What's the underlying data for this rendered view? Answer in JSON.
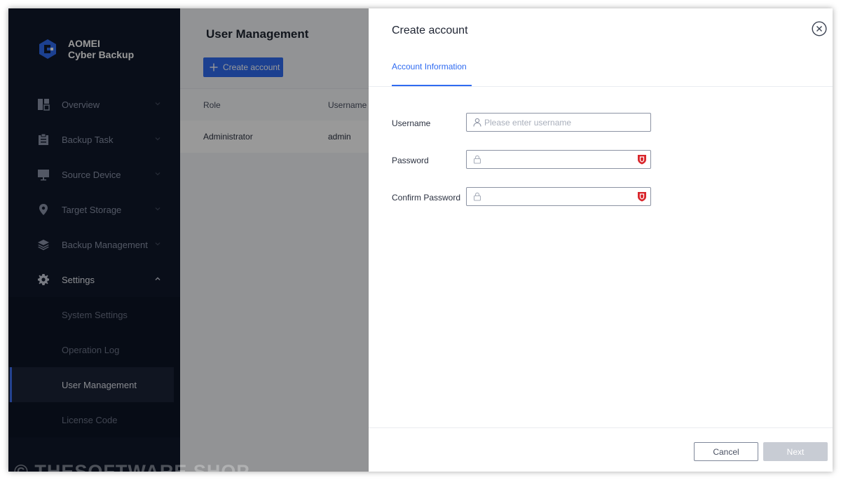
{
  "app": {
    "brand_line1": "AOMEI",
    "brand_line2": "Cyber Backup",
    "accent_color": "#2f6bf1",
    "sidebar_color": "#10182b"
  },
  "sidebar": {
    "items": [
      {
        "label": "Overview",
        "icon": "dashboard-icon"
      },
      {
        "label": "Backup Task",
        "icon": "clipboard-icon"
      },
      {
        "label": "Source Device",
        "icon": "monitor-icon"
      },
      {
        "label": "Target Storage",
        "icon": "location-pin-icon"
      },
      {
        "label": "Backup Management",
        "icon": "layers-icon"
      },
      {
        "label": "Settings",
        "icon": "gear-icon"
      }
    ],
    "settings_sub": [
      {
        "label": "System Settings"
      },
      {
        "label": "Operation Log"
      },
      {
        "label": "User Management"
      },
      {
        "label": "License Code"
      }
    ]
  },
  "main": {
    "title": "User Management",
    "create_button": "Create account",
    "columns": [
      "Role",
      "Username"
    ],
    "rows": [
      {
        "role": "Administrator",
        "username": "admin"
      }
    ]
  },
  "drawer": {
    "title": "Create account",
    "tab": "Account Information",
    "fields": {
      "username_label": "Username",
      "username_placeholder": "Please enter username",
      "password_label": "Password",
      "confirm_label": "Confirm Password"
    },
    "cancel": "Cancel",
    "next": "Next"
  },
  "watermark": "© THESOFTWARE.SHOP"
}
